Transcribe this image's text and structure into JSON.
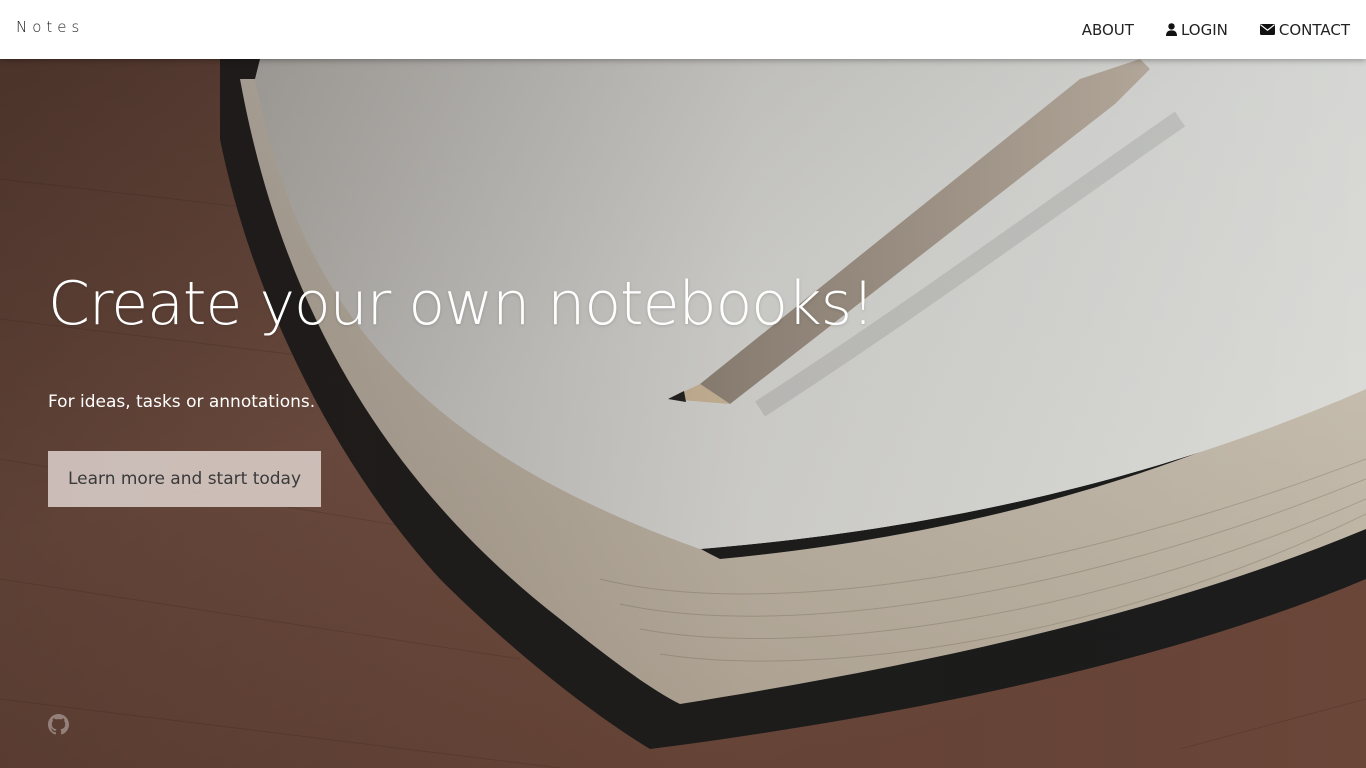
{
  "navbar": {
    "brand": "Notes",
    "links": [
      {
        "label": "ABOUT",
        "icon": ""
      },
      {
        "label": "LOGIN",
        "icon": "user-icon"
      },
      {
        "label": "CONTACT",
        "icon": "envelope-icon"
      }
    ]
  },
  "hero": {
    "title": "Create your own notebooks!",
    "subtitle": "For ideas, tasks or annotations.",
    "cta_label": "Learn more and start today",
    "background": "open-notebook-with-pencil-on-wooden-table",
    "footer_icon": "github-icon"
  },
  "colors": {
    "navbar_bg": "#ffffff",
    "nav_text": "#222222",
    "hero_text": "#ffffff",
    "cta_bg": "#ded2ce",
    "cta_text": "#3a3a3a",
    "table_wood": "#6b4a3f",
    "paper": "#d2d3d0"
  }
}
